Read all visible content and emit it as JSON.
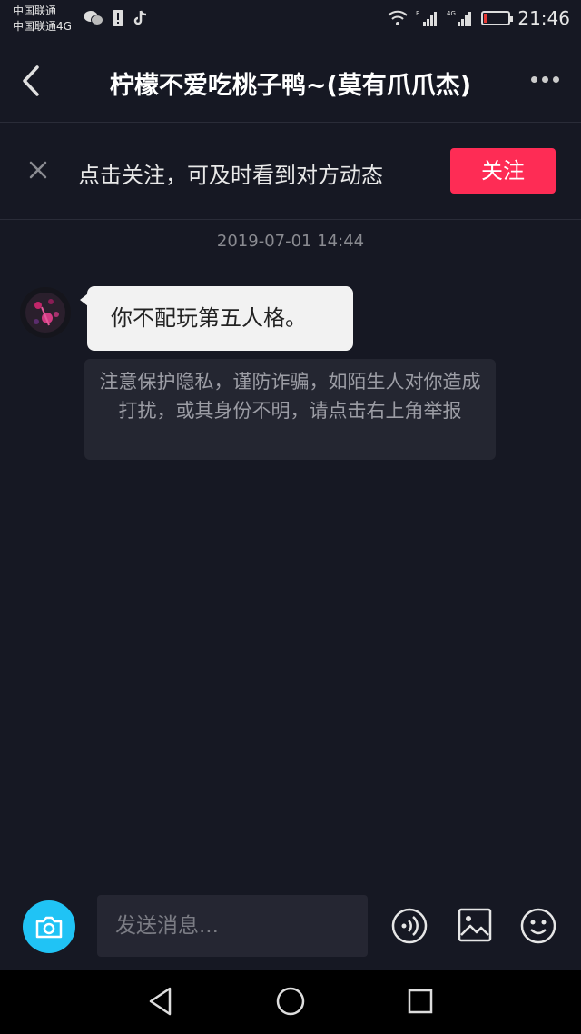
{
  "status_bar": {
    "carrier_line1": "中国联通",
    "carrier_line2": "中国联通4G",
    "network_label": "4G",
    "time": "21:46",
    "battery_color": "#e53935"
  },
  "header": {
    "title": "柠檬不爱吃桃子鸭~(莫有爪爪杰)",
    "back_icon": "chevron-left-icon",
    "more_icon": "more-dots-icon"
  },
  "follow_banner": {
    "hint": "点击关注，可及时看到对方动态",
    "button_label": "关注",
    "button_color": "#fe2c55",
    "close_icon": "close-icon"
  },
  "chat": {
    "timestamp": "2019-07-01 14:44",
    "messages": [
      {
        "sender": "other",
        "text": "你不配玩第五人格。"
      }
    ],
    "notice": "注意保护隐私，谨防诈骗，如陌生人对你造成打扰，或其身份不明，请点击右上角举报"
  },
  "input_bar": {
    "placeholder": "发送消息...",
    "camera_color": "#20c3f5",
    "icons": [
      "camera-icon",
      "voice-icon",
      "image-icon",
      "emoji-icon"
    ]
  },
  "nav_bar": {
    "icons": [
      "back-triangle-icon",
      "home-circle-icon",
      "recents-square-icon"
    ]
  }
}
